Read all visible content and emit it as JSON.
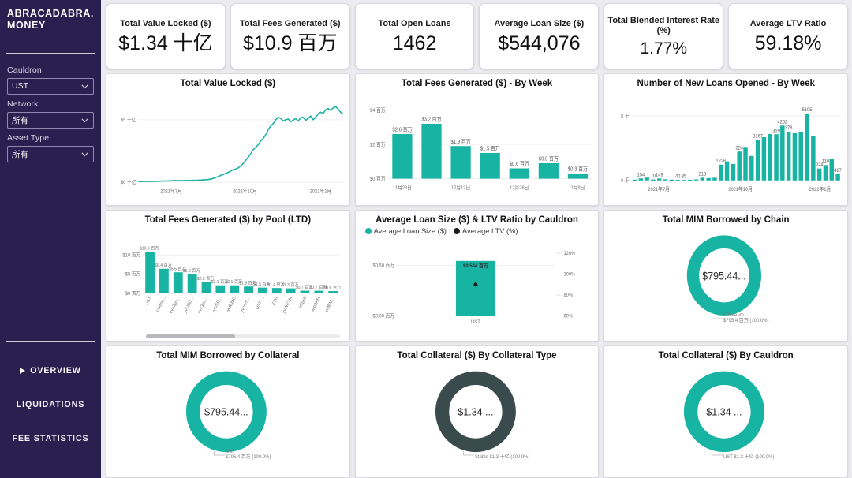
{
  "sidebar": {
    "brand": "ABRACADABRA.\nMONEY",
    "brand_line1": "ABRACADABRA.",
    "brand_line2": "MONEY",
    "filters": [
      {
        "label": "Cauldron",
        "value": "UST",
        "icon": "chevron-down-icon"
      },
      {
        "label": "Network",
        "value": "所有",
        "icon": "chevron-down-icon"
      },
      {
        "label": "Asset Type",
        "value": "所有",
        "icon": "chevron-down-icon"
      }
    ],
    "nav": [
      {
        "label": "OVERVIEW",
        "selected": true
      },
      {
        "label": "LIQUIDATIONS",
        "selected": false
      },
      {
        "label": "FEE STATISTICS",
        "selected": false
      }
    ]
  },
  "kpis": [
    {
      "label": "Total Value Locked ($)",
      "value": "$1.34 十亿"
    },
    {
      "label": "Total Fees Generated ($)",
      "value": "$10.9 百万"
    },
    {
      "label": "Total Open Loans",
      "value": "1462"
    },
    {
      "label": "Average Loan Size ($)",
      "value": "$544,076"
    },
    {
      "label": "Total Blended Interest Rate (%)",
      "value": "1.77%"
    },
    {
      "label": "Average LTV Ratio",
      "value": "59.18%"
    }
  ],
  "colors": {
    "accent": "#17b3a3",
    "sidebar": "#2a2050",
    "dark_slate": "#3a4b4d",
    "card": "#ffffff",
    "canvas": "#ebebf0"
  },
  "chart_data": [
    {
      "id": "total-value-locked",
      "type": "line",
      "title": "Total Value Locked ($)",
      "xlabel": "",
      "ylabel": "",
      "ytick_labels": [
        "$0 十亿",
        "$5 十亿"
      ],
      "ylim": [
        0,
        6.2
      ],
      "xtick_labels": [
        "2021年7月",
        "2021年10月",
        "2022年1月"
      ],
      "grid": true,
      "series": [
        {
          "name": "Total Value Locked ($)",
          "values": [
            0.05,
            0.06,
            0.06,
            0.07,
            0.07,
            0.06,
            0.07,
            0.08,
            0.08,
            0.09,
            0.09,
            0.1,
            0.1,
            0.11,
            0.12,
            0.12,
            0.13,
            0.12,
            0.13,
            0.13,
            0.14,
            0.14,
            0.15,
            0.15,
            0.16,
            0.17,
            0.18,
            0.2,
            0.22,
            0.25,
            0.3,
            0.38,
            0.45,
            0.55,
            0.62,
            0.7,
            0.78,
            0.9,
            1.0,
            1.05,
            1.15,
            1.3,
            1.5,
            1.75,
            2.0,
            2.3,
            2.6,
            2.8,
            3.0,
            3.3,
            3.5,
            3.8,
            4.2,
            4.5,
            4.7,
            5.0,
            5.2,
            5.1,
            4.9,
            5.0,
            5.05,
            4.85,
            4.95,
            5.1,
            4.9,
            5.15,
            5.2,
            4.95,
            5.1,
            5.3,
            5.0,
            5.2,
            5.45,
            5.6,
            5.5,
            5.8,
            5.9,
            5.75,
            5.95,
            6.05,
            5.85,
            5.6,
            5.45
          ]
        }
      ]
    },
    {
      "id": "total-fees-by-week",
      "type": "bar",
      "title": "Total Fees Generated ($) - By Week",
      "ytick_labels": [
        "$0 百万",
        "$2 百万",
        "$4 百万"
      ],
      "ylim": [
        0,
        4
      ],
      "xtick_labels": [
        "11月28日",
        "12月12日",
        "12月26日",
        "1月9日"
      ],
      "categories": [
        "11月28日",
        "12月5日",
        "12月12日",
        "12月19日",
        "12月26日",
        "1月2日",
        "1月9日"
      ],
      "values": [
        2.6,
        3.2,
        1.9,
        1.5,
        0.6,
        0.9,
        0.3
      ],
      "data_labels": [
        "$2.6 百万",
        "$3.2 百万",
        "$1.9 百万",
        "$1.5 百万",
        "$0.6 百万",
        "$0.9 百万",
        "$0.3 百万"
      ]
    },
    {
      "id": "new-loans-by-week",
      "type": "bar",
      "title": "Number of New Loans Opened - By Week",
      "ytick_labels": [
        "0 千",
        "5 千"
      ],
      "ylim": [
        0,
        5600
      ],
      "xtick_labels": [
        "2021年7月",
        "2021年10月",
        "2022年1月"
      ],
      "values": [
        60,
        154,
        220,
        70,
        149,
        90,
        60,
        40,
        35,
        50,
        80,
        213,
        180,
        210,
        1226,
        1480,
        1280,
        2240,
        2600,
        1900,
        3167,
        3350,
        3600,
        3590,
        4252,
        3780,
        3700,
        3780,
        5195,
        3450,
        924,
        1190,
        1650,
        487
      ],
      "visible_data_labels": [
        "154",
        "70",
        "149",
        "40",
        "35",
        "213",
        "1226",
        "224",
        "3167",
        "359",
        "4252",
        "378",
        "5195",
        "924",
        "119",
        "487"
      ]
    },
    {
      "id": "fees-by-pool",
      "type": "bar",
      "title": "Total Fees Generated ($) by Pool (LTD)",
      "ytick_labels": [
        "$0 百万",
        "$5 百万",
        "$10 百万"
      ],
      "ylim": [
        0,
        11.5
      ],
      "categories": [
        "UST",
        "cvxtric...",
        "cvx3po...",
        "yvUSD...",
        "cvx3po...",
        "yvUSD...",
        "wMEMO",
        "yvcrvS...",
        "UST ...",
        "ETH",
        "yvWFTM",
        "xSpell",
        "wsOHM",
        "wMEM..."
      ],
      "values": [
        10.9,
        6.4,
        5.5,
        5.0,
        2.9,
        2.1,
        2.1,
        1.8,
        1.5,
        1.4,
        1.3,
        0.7,
        0.7,
        0.6
      ],
      "data_labels": [
        "$10.9 百万",
        "$6.4 百万",
        "$5.5 百万",
        "$5.0 百万",
        "$2.9 百万",
        "$2.1 百万",
        "$2.1 百万",
        "$1.8 百万",
        "$1.5 百万",
        "$1.4 百万",
        "$1.3 百万",
        "$0.7 百万",
        "$0.7 百万",
        "$0.6 百万"
      ],
      "has_scrollbar": true
    },
    {
      "id": "avg-loan-size-ltv",
      "type": "bar",
      "title": "Average Loan Size ($) & LTV Ratio by Cauldron",
      "legend": [
        {
          "label": "Average Loan Size ($)",
          "color": "#17b3a3",
          "marker": "circle"
        },
        {
          "label": "Average LTV (%)",
          "color": "#1d1d1d",
          "marker": "circle"
        }
      ],
      "categories": [
        "UST"
      ],
      "ytick_labels": [
        "$0.00 百万",
        "$0.50 百万"
      ],
      "ylim": [
        0,
        0.62
      ],
      "y2tick_labels": [
        "60%",
        "80%",
        "100%",
        "120%"
      ],
      "y2lim": [
        60,
        120
      ],
      "values": [
        0.544
      ],
      "data_labels": [
        "$0.544 百万"
      ],
      "ltv_values": [
        90
      ]
    },
    {
      "id": "mim-by-chain",
      "type": "pie",
      "title": "Total MIM Borrowed by Chain",
      "center_label": "$795.44...",
      "color": "#17b3a3",
      "slices": [
        {
          "name": "Ethereum",
          "value": 795.4,
          "percent": "100.0%",
          "label": "Ethereum\n$795.4 百万 (100.0%)",
          "label_line1": "Ethereum",
          "label_line2": "$795.4 百万 (100.0%)"
        }
      ]
    },
    {
      "id": "mim-by-collateral",
      "type": "pie",
      "title": "Total MIM Borrowed by Collateral",
      "center_label": "$795.44...",
      "color": "#17b3a3",
      "slices": [
        {
          "name": "UST",
          "value": 795.4,
          "percent": "100.0%",
          "label_line1": "UST",
          "label_line2": "$795.4 百万 (100.0%)"
        }
      ]
    },
    {
      "id": "collateral-by-type",
      "type": "pie",
      "title": "Total Collateral ($) By Collateral Type",
      "center_label": "$1.34 ...",
      "color": "#3a4b4d",
      "slices": [
        {
          "name": "Stable",
          "value": 1.3,
          "percent": "100.0%",
          "label_line1": "",
          "label_line2": "Stable $1.3 十亿 (100.0%)"
        }
      ]
    },
    {
      "id": "collateral-by-cauldron",
      "type": "pie",
      "title": "Total Collateral ($) By Cauldron",
      "center_label": "$1.34 ...",
      "color": "#17b3a3",
      "slices": [
        {
          "name": "UST",
          "value": 1.3,
          "percent": "100.0%",
          "label_line1": "",
          "label_line2": "UST $1.3 十亿 (100.0%)"
        }
      ]
    }
  ]
}
